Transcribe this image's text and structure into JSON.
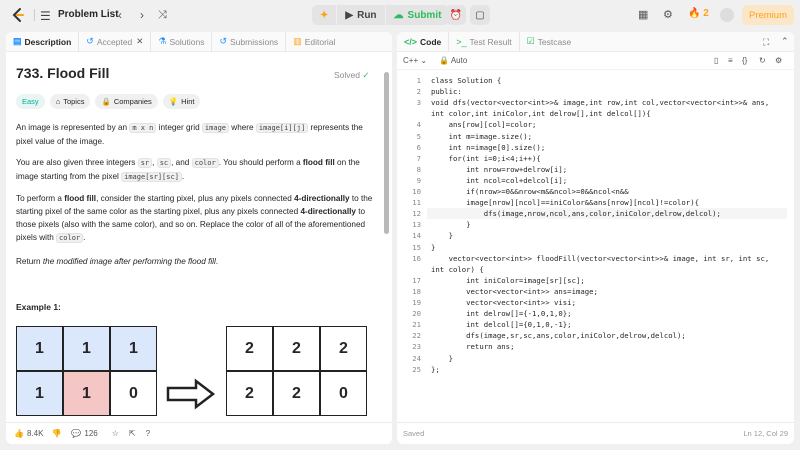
{
  "topbar": {
    "title": "Problem List",
    "run_label": "Run",
    "submit_label": "Submit",
    "streak_count": "2",
    "premium_label": "Premium"
  },
  "left_tabs": [
    "Description",
    "Accepted",
    "Solutions",
    "Submissions",
    "Editorial"
  ],
  "problem": {
    "title": "733. Flood Fill",
    "status": "Solved",
    "chips": [
      "Easy",
      "Topics",
      "Companies",
      "Hint"
    ],
    "p1_a": "An image is represented by an ",
    "p1_code1": "m x n",
    "p1_b": " integer grid ",
    "p1_code2": "image",
    "p1_c": " where ",
    "p1_code3": "image[i][j]",
    "p1_d": " represents the pixel value of the image.",
    "p2_a": "You are also given three integers ",
    "p2_code1": "sr",
    "p2_b": ", ",
    "p2_code2": "sc",
    "p2_c": ", and ",
    "p2_code3": "color",
    "p2_d": ". You should perform a ",
    "p2_bold": "flood fill",
    "p2_e": " on the image starting from the pixel ",
    "p2_code4": "image[sr][sc]",
    "p2_f": ".",
    "p3_a": "To perform a ",
    "p3_bold1": "flood fill",
    "p3_b": ", consider the starting pixel, plus any pixels connected ",
    "p3_bold2": "4-directionally",
    "p3_c": " to the starting pixel of the same color as the starting pixel, plus any pixels connected ",
    "p3_bold3": "4-directionally",
    "p3_d": " to those pixels (also with the same color), and so on. Replace the color of all of the aforementioned pixels with ",
    "p3_code": "color",
    "p3_e": ".",
    "p4_a": "Return ",
    "p4_italic": "the modified image after performing the flood fill",
    "p4_b": ".",
    "example_title": "Example 1:",
    "grid_before": [
      [
        "1",
        "1",
        "1"
      ],
      [
        "1",
        "1",
        "0"
      ]
    ],
    "grid_after": [
      [
        "2",
        "2",
        "2"
      ],
      [
        "2",
        "2",
        "0"
      ]
    ]
  },
  "footer": {
    "likes": "8.4K",
    "comments": "126"
  },
  "right_tabs": [
    "Code",
    "Test Result",
    "Testcase"
  ],
  "editor": {
    "language": "C++",
    "mode": "Auto",
    "saved": "Saved",
    "cursor": "Ln 12, Col 29"
  },
  "code_lines": [
    {
      "n": "1",
      "t": "class Solution {"
    },
    {
      "n": "2",
      "t": "public:"
    },
    {
      "n": "3",
      "t": "void dfs(vector<vector<int>>& image,int row,int col,vector<vector<int>>& ans,"
    },
    {
      "n": "",
      "t": "int color,int iniColor,int delrow[],int delcol[]){"
    },
    {
      "n": "4",
      "t": "    ans[row][col]=color;"
    },
    {
      "n": "5",
      "t": "    int m=image.size();"
    },
    {
      "n": "6",
      "t": "    int n=image[0].size();"
    },
    {
      "n": "7",
      "t": "    for(int i=0;i<4;i++){"
    },
    {
      "n": "8",
      "t": "        int nrow=row+delrow[i];"
    },
    {
      "n": "9",
      "t": "        int ncol=col+delcol[i];"
    },
    {
      "n": "10",
      "t": "        if(nrow>=0&&nrow<m&&ncol>=0&&ncol<n&&"
    },
    {
      "n": "11",
      "t": "        image[nrow][ncol]==iniColor&&ans[nrow][ncol]!=color){"
    },
    {
      "n": "12",
      "t": "            dfs(image,nrow,ncol,ans,color,iniColor,delrow,delcol);"
    },
    {
      "n": "13",
      "t": "        }"
    },
    {
      "n": "14",
      "t": "    }"
    },
    {
      "n": "15",
      "t": "}"
    },
    {
      "n": "16",
      "t": "    vector<vector<int>> floodFill(vector<vector<int>>& image, int sr, int sc,"
    },
    {
      "n": "",
      "t": "int color) {"
    },
    {
      "n": "17",
      "t": "        int iniColor=image[sr][sc];"
    },
    {
      "n": "18",
      "t": "        vector<vector<int>> ans=image;"
    },
    {
      "n": "19",
      "t": "        vector<vector<int>> visi;"
    },
    {
      "n": "20",
      "t": "        int delrow[]={-1,0,1,0};"
    },
    {
      "n": "21",
      "t": "        int delcol[]={0,1,0,-1};"
    },
    {
      "n": "22",
      "t": "        dfs(image,sr,sc,ans,color,iniColor,delrow,delcol);"
    },
    {
      "n": "23",
      "t": "        return ans;"
    },
    {
      "n": "24",
      "t": "    }"
    },
    {
      "n": "25",
      "t": "};"
    }
  ],
  "colors": {
    "accent": "#ffa116",
    "submit_green": "#2cbb5d",
    "cell_blue": "#dbe8fb",
    "cell_red": "#f5c6c6"
  }
}
